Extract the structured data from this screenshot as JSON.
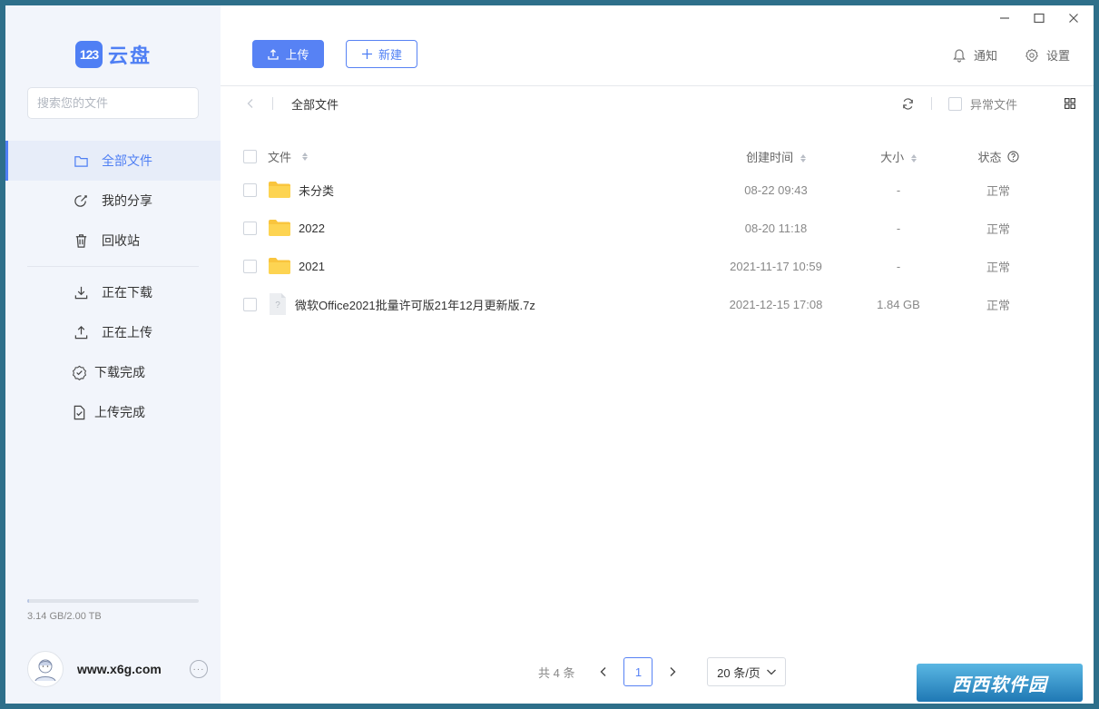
{
  "app": {
    "logo_badge": "123",
    "logo_text": "云盘"
  },
  "sidebar": {
    "search_placeholder": "搜索您的文件",
    "items": [
      {
        "label": "全部文件",
        "icon": "folder-icon",
        "active": true
      },
      {
        "label": "我的分享",
        "icon": "share-icon",
        "active": false
      },
      {
        "label": "回收站",
        "icon": "trash-icon",
        "active": false
      }
    ],
    "transfer_items": [
      {
        "label": "正在下载",
        "icon": "download-icon"
      },
      {
        "label": "正在上传",
        "icon": "upload-icon"
      },
      {
        "label": "下载完成",
        "icon": "check-circle-icon"
      },
      {
        "label": "上传完成",
        "icon": "file-check-icon"
      }
    ],
    "storage_text": "3.14 GB/2.00 TB",
    "storage_fraction": 0.0016,
    "username": "www.x6g.com"
  },
  "toolbar": {
    "upload_label": "上传",
    "new_label": "新建",
    "notify_label": "通知",
    "settings_label": "设置"
  },
  "pathbar": {
    "crumb": "全部文件",
    "abnormal_label": "异常文件"
  },
  "table": {
    "headers": {
      "name": "文件",
      "time": "创建时间",
      "size": "大小",
      "status": "状态"
    },
    "rows": [
      {
        "name": "未分类",
        "type": "folder",
        "time": "08-22 09:43",
        "size": "-",
        "status": "正常"
      },
      {
        "name": "2022",
        "type": "folder",
        "time": "08-20 11:18",
        "size": "-",
        "status": "正常"
      },
      {
        "name": "2021",
        "type": "folder",
        "time": "2021-11-17 10:59",
        "size": "-",
        "status": "正常"
      },
      {
        "name": "微软Office2021批量许可版21年12月更新版.7z",
        "type": "file",
        "time": "2021-12-15 17:08",
        "size": "1.84 GB",
        "status": "正常"
      }
    ]
  },
  "pager": {
    "total": "共 4 条",
    "current": "1",
    "page_size": "20 条/页"
  },
  "watermark": "西西软件园",
  "colors": {
    "accent": "#5782f4",
    "sidebar_bg": "#f2f5fb",
    "folder": "#f9c53e"
  }
}
